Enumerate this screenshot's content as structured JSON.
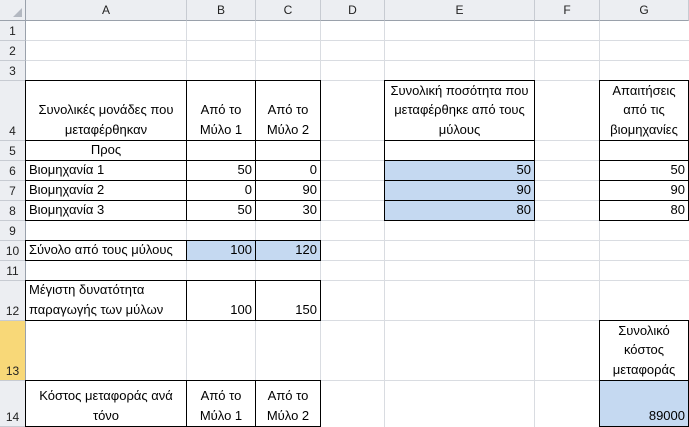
{
  "columns": [
    "A",
    "B",
    "C",
    "D",
    "E",
    "F",
    "G"
  ],
  "rows": [
    "1",
    "2",
    "3",
    "4",
    "5",
    "6",
    "7",
    "8",
    "9",
    "10",
    "11",
    "12",
    "13",
    "14"
  ],
  "cells": {
    "A4": "Συνολικές μονάδες που μεταφέρθηκαν",
    "B4": "Από το Μύλο 1",
    "C4": "Από το Μύλο 2",
    "E4": "Συνολική ποσότητα που μεταφέρθηκε από τους μύλους",
    "G4": "Απαιτήσεις από τις βιομηχανίες",
    "A5": "Προς",
    "A6": "Βιομηχανία 1",
    "B6": "50",
    "C6": "0",
    "E6": "50",
    "G6": "50",
    "A7": "Βιομηχανία 2",
    "B7": "0",
    "C7": "90",
    "E7": "90",
    "G7": "90",
    "A8": "Βιομηχανία 3",
    "B8": "50",
    "C8": "30",
    "E8": "80",
    "G8": "80",
    "A10": "Σύνολο από τους μύλους",
    "B10": "100",
    "C10": "120",
    "A12": "Μέγιστη δυνατότητα παραγωγής των μύλων",
    "B12": "100",
    "C12": "150",
    "G13": "Συνολικό κόστος μεταφοράς",
    "A14": "Κόστος μεταφοράς ανά τόνο",
    "B14": "Από το Μύλο 1",
    "C14": "Από το Μύλο 2",
    "G14": "89000"
  },
  "colors": {
    "highlight": "#c5d9f1",
    "selected_row_header": "#f8d878",
    "header_bg": "#eceef2"
  }
}
